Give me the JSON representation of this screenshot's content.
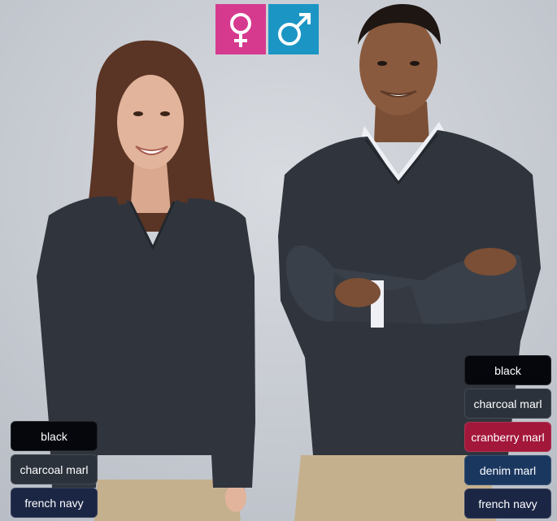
{
  "gender_badges": [
    {
      "symbol": "female-symbol",
      "color": "#d63a8e"
    },
    {
      "symbol": "male-symbol",
      "color": "#1b96c4"
    }
  ],
  "women_colors": [
    {
      "label": "black",
      "color": "#05070c"
    },
    {
      "label": "charcoal marl",
      "color": "#2b323b"
    },
    {
      "label": "french navy",
      "color": "#1b2645"
    }
  ],
  "men_colors": [
    {
      "label": "black",
      "color": "#05070c"
    },
    {
      "label": "charcoal marl",
      "color": "#2b323b"
    },
    {
      "label": "cranberry marl",
      "color": "#a3173b"
    },
    {
      "label": "denim marl",
      "color": "#1a3760"
    },
    {
      "label": "french navy",
      "color": "#1b2645"
    }
  ],
  "palette": {
    "backdrop": "#c8ccd2",
    "sweater": "#30353d",
    "skin_woman": "#e2b49b",
    "skin_man": "#8a5a3e",
    "hair_woman": "#5a3424",
    "hair_man": "#1e1612",
    "pants": "#c5b08d",
    "shirt": "#eef0f5"
  }
}
